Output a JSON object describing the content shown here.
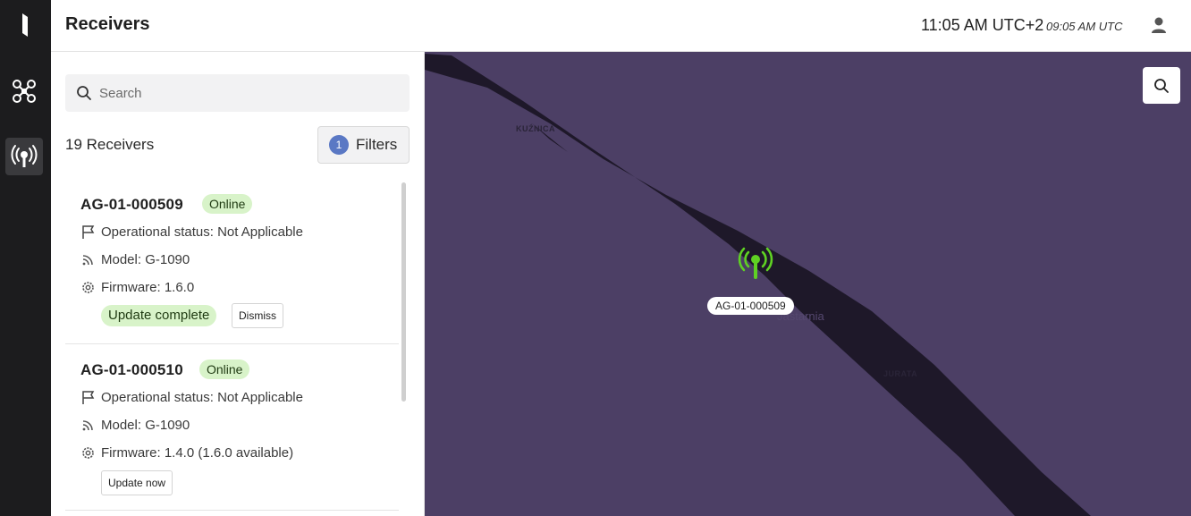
{
  "header": {
    "title": "Receivers",
    "local_time": "11:05 AM UTC+2",
    "utc_time": "09:05 AM UTC"
  },
  "sidebar": {
    "items": [
      {
        "name": "drones",
        "icon": "drone-icon",
        "active": false
      },
      {
        "name": "receivers",
        "icon": "antenna-icon",
        "active": true
      }
    ]
  },
  "panel": {
    "search_placeholder": "Search",
    "count_label": "19 Receivers",
    "filters_count": "1",
    "filters_label": "Filters",
    "receivers": [
      {
        "name": "AG-01-000509",
        "status": "Online",
        "operational": "Operational status: Not Applicable",
        "model": "Model: G-1090",
        "firmware": "Firmware: 1.6.0",
        "update_status": "Update complete",
        "action": "Dismiss"
      },
      {
        "name": "AG-01-000510",
        "status": "Online",
        "operational": "Operational status: Not Applicable",
        "model": "Model: G-1090",
        "firmware": "Firmware: 1.4.0 (1.6.0 available)",
        "action": "Update now"
      }
    ]
  },
  "map": {
    "places": [
      "KUŹNICA",
      "JURATA"
    ],
    "town": "Jastarnia",
    "marker_label": "AG-01-000509",
    "colors": {
      "water": "#4c3f65",
      "land": "#1e1829",
      "marker": "#5fd123"
    }
  }
}
